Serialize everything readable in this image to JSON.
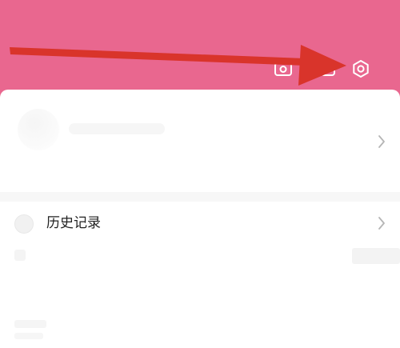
{
  "header": {
    "background_color": "#e9678f",
    "icons": [
      "camera-icon",
      "scan-icon",
      "gear-icon"
    ]
  },
  "menu": {
    "history_label": "历史记录"
  },
  "annotation": {
    "arrow_color": "#d9342b"
  }
}
